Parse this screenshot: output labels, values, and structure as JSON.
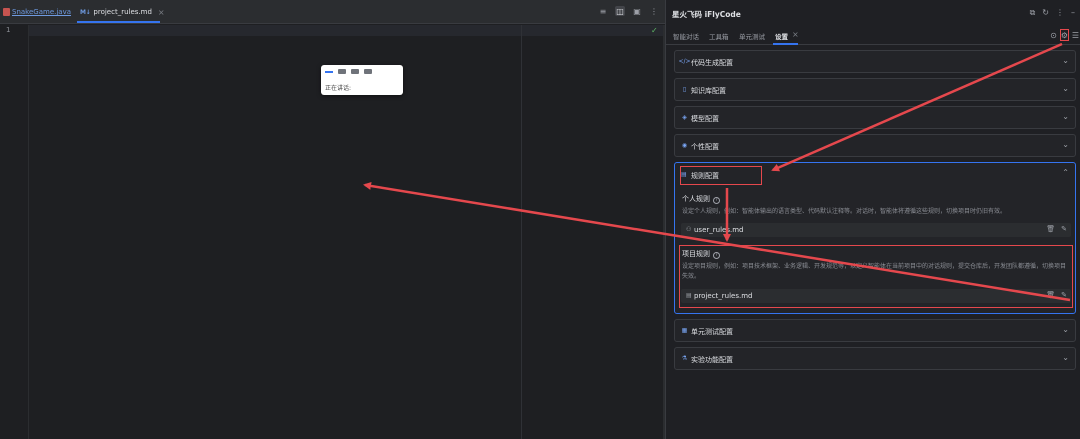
{
  "editor": {
    "tabs": [
      {
        "label": "SnakeGame.java",
        "active": false
      },
      {
        "label": "project_rules.md",
        "badge": "M↓",
        "active": true
      }
    ],
    "line_numbers": [
      "1"
    ],
    "voice_popup": {
      "status": "正在讲话:"
    }
  },
  "panel": {
    "title": "星火飞码 iFlyCode",
    "tabs": [
      "智能对话",
      "工具箱",
      "单元测试",
      "设置"
    ],
    "active_tab": "设置",
    "sections": [
      {
        "label": "代码生成配置",
        "icon": "code-icon"
      },
      {
        "label": "知识库配置",
        "icon": "book-icon"
      },
      {
        "label": "模型配置",
        "icon": "cube-icon"
      },
      {
        "label": "个性配置",
        "icon": "person-icon"
      }
    ],
    "rules": {
      "label": "规则配置",
      "personal": {
        "title": "个人规则",
        "desc": "设定个人规则，例如：智能体输出的语言类型、代码默认注释等。对话时，智能体将遵循这些规则，切换项目时仍旧有效。",
        "file": "user_rules.md"
      },
      "project": {
        "title": "项目规则",
        "desc": "设定项目规则，例如：项目技术框架、业务逻辑、开发规范等，以定义智能体在当前项目中的对话规则，提交仓库后，开发团队都遵循，切换项目失效。",
        "file": "project_rules.md"
      }
    },
    "bottom_sections": [
      {
        "label": "单元测试配置",
        "icon": "test-icon"
      },
      {
        "label": "实验功能配置",
        "icon": "flask-icon"
      }
    ]
  },
  "colors": {
    "accent": "#3574f0",
    "annotation": "#e5484d",
    "background": "#1e1f22"
  }
}
